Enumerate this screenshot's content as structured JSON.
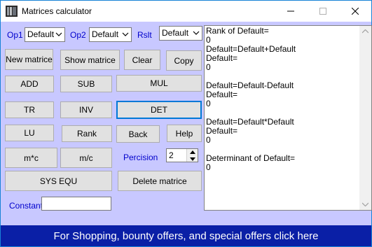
{
  "window": {
    "title": "Matrices calculator"
  },
  "operands": {
    "op1_label": "Op1",
    "op1_value": "Default",
    "op2_label": "Op2",
    "op2_value": "Default",
    "rslt_label": "Rslt",
    "rslt_value": "Default"
  },
  "buttons": {
    "new_matrice": "New matrice",
    "show_matrice": "Show matrice",
    "clear": "Clear",
    "copy": "Copy",
    "add": "ADD",
    "sub": "SUB",
    "mul": "MUL",
    "tr": "TR",
    "inv": "INV",
    "det": "DET",
    "lu": "LU",
    "rank": "Rank",
    "back": "Back",
    "help": "Help",
    "m_times_c": "m*c",
    "m_div_c": "m/c",
    "sys_equ": "SYS EQU",
    "delete_matrice": "Delete matrice"
  },
  "precision": {
    "label": "Percision",
    "value": "2"
  },
  "constant": {
    "label": "Constant",
    "value": ""
  },
  "output_lines": [
    "Rank of Default=",
    "0",
    "Default=Default+Default",
    "Default=",
    "0",
    "",
    "Default=Default-Default",
    "Default=",
    "0",
    "",
    "Default=Default*Default",
    "Default=",
    "0",
    "",
    "Determinant of Default=",
    "0"
  ],
  "banner": {
    "text": "For Shopping, bounty offers, and special offers click here"
  },
  "colors": {
    "client_bg": "#c8c8ff",
    "label_blue": "#0000cc",
    "banner_bg": "#0a1fa6",
    "focus_border": "#0078d7"
  }
}
